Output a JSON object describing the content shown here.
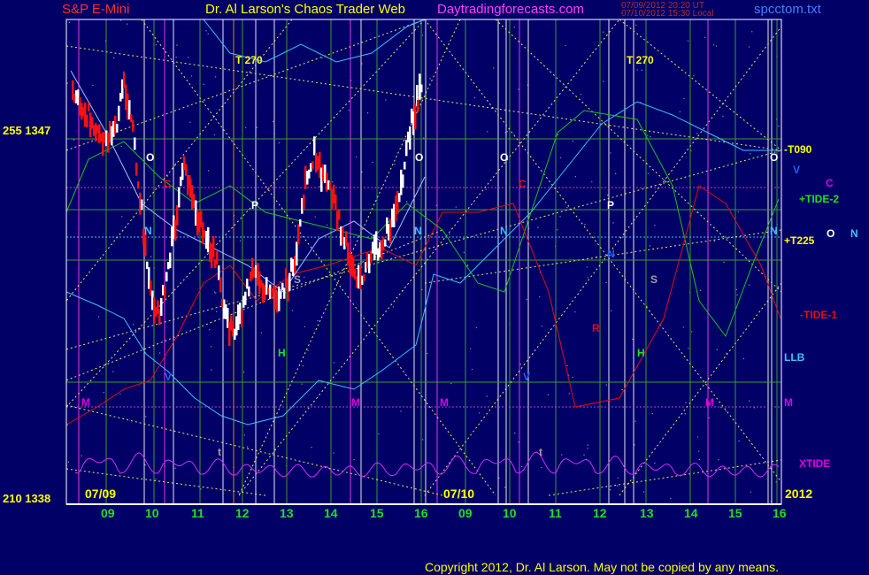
{
  "header": {
    "instrument": "S&P E-Mini",
    "author": "Dr. Al Larson's Chaos Trader Web",
    "website": "Daytradingforecasts.com",
    "date1": "07/09/2012 20:20 UT",
    "date2": "07/10/2012 15:30 Local",
    "file": "spcctom.txt"
  },
  "copyright": "Copyright 2012, Dr. Al Larson. May not be copied by any means.",
  "colors": {
    "background": "#000066",
    "grid": "#4a9a3a",
    "price_up": "#ffffff",
    "price_down": "#ff1010",
    "yellow": "#ffff00",
    "cyan": "#40c0ff",
    "green": "#20c020",
    "red": "#e01010",
    "magenta": "#c030ff"
  },
  "chart_data": {
    "type": "line",
    "y_axis": {
      "left_labels": [
        {
          "text": "255 1347",
          "value": 1347
        },
        {
          "text": "210 1338",
          "value": 1338
        }
      ]
    },
    "x_axis": {
      "day_labels": [
        "07/09",
        "07/10"
      ],
      "year_label": "2012",
      "hour_ticks": [
        "09",
        "10",
        "11",
        "12",
        "13",
        "14",
        "15",
        "16",
        "09",
        "10",
        "11",
        "12",
        "13",
        "14",
        "15",
        "16"
      ]
    },
    "right_labels": [
      {
        "text": "-T090",
        "color": "#ffff00"
      },
      {
        "text": "V",
        "color": "#2060ff"
      },
      {
        "text": "C",
        "color": "#e000e0"
      },
      {
        "text": "+TIDE-2",
        "color": "#20e020"
      },
      {
        "text": "O",
        "color": "#ffffff"
      },
      {
        "text": "N",
        "color": "#40c0ff"
      },
      {
        "text": "+T225",
        "color": "#ffff00"
      },
      {
        "text": "-TIDE-1",
        "color": "#e01010"
      },
      {
        "text": "LLB",
        "color": "#40c0ff"
      },
      {
        "text": "M",
        "color": "#e000e0"
      },
      {
        "text": "XTIDE",
        "color": "#e000e0"
      }
    ],
    "t_labels": [
      "T 270",
      "T 270"
    ],
    "planet_markers": [
      {
        "text": "O",
        "color": "#ffffff"
      },
      {
        "text": "C",
        "color": "#e01010"
      },
      {
        "text": "N",
        "color": "#40c0ff"
      },
      {
        "text": "P",
        "color": "#ffffff"
      },
      {
        "text": "S",
        "color": "#a0a0a0"
      },
      {
        "text": "H",
        "color": "#20e020"
      },
      {
        "text": "V",
        "color": "#2060ff"
      },
      {
        "text": "M",
        "color": "#e000e0"
      },
      {
        "text": "t",
        "color": "#a0a0a0"
      },
      {
        "text": "O",
        "color": "#ffffff"
      },
      {
        "text": "N",
        "color": "#40c0ff"
      },
      {
        "text": "M",
        "color": "#e000e0"
      },
      {
        "text": "O",
        "color": "#ffffff"
      },
      {
        "text": "C",
        "color": "#e01010"
      },
      {
        "text": "N",
        "color": "#40c0ff"
      },
      {
        "text": "V",
        "color": "#2060ff"
      },
      {
        "text": "t",
        "color": "#a0a0a0"
      },
      {
        "text": "P",
        "color": "#ffffff"
      },
      {
        "text": "N",
        "color": "#2060ff"
      },
      {
        "text": "S",
        "color": "#a0a0a0"
      },
      {
        "text": "R",
        "color": "#e01010"
      },
      {
        "text": "H",
        "color": "#20e020"
      },
      {
        "text": "M",
        "color": "#e000e0"
      },
      {
        "text": "O",
        "color": "#ffffff"
      },
      {
        "text": "N",
        "color": "#40c0ff"
      },
      {
        "text": "M",
        "color": "#e000e0"
      }
    ]
  }
}
